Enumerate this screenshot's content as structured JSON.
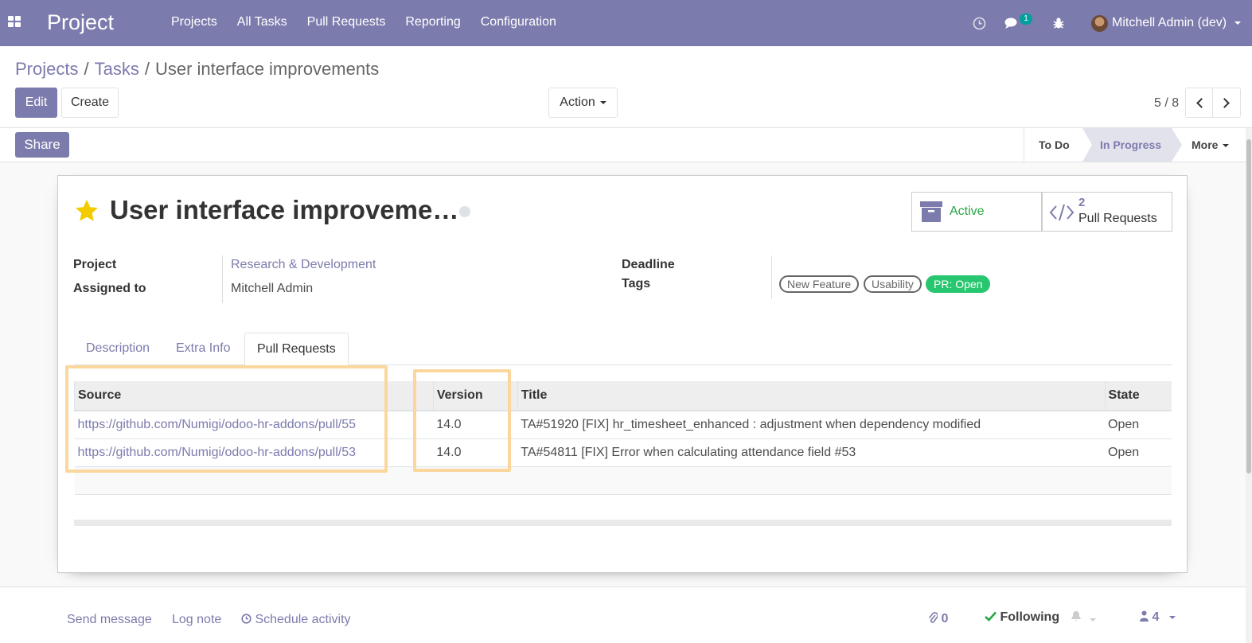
{
  "navbar": {
    "app_title": "Project",
    "menu": [
      "Projects",
      "All Tasks",
      "Pull Requests",
      "Reporting",
      "Configuration"
    ],
    "messages_count": "1",
    "user": "Mitchell Admin (dev)",
    "icons": [
      "apps-icon",
      "clock-icon",
      "comments-icon",
      "bug-icon",
      "avatar"
    ]
  },
  "breadcrumb": {
    "projects": "Projects",
    "tasks": "Tasks",
    "current": "User interface improvements",
    "separator": "/"
  },
  "toolbar": {
    "edit": "Edit",
    "create": "Create",
    "action": "Action",
    "pager": "5 / 8"
  },
  "statusbar": {
    "share": "Share",
    "stages": [
      "To Do",
      "In Progress"
    ],
    "active_stage": "In Progress",
    "more": "More"
  },
  "task": {
    "title": "User interface improveme…",
    "active_label": "Active",
    "pr_count": "2",
    "pr_label": "Pull Requests",
    "fields": {
      "project_label": "Project",
      "project_value": "Research & Development",
      "assigned_label": "Assigned to",
      "assigned_value": "Mitchell Admin",
      "deadline_label": "Deadline",
      "tags_label": "Tags"
    },
    "tags": [
      "New Feature",
      "Usability",
      "PR: Open"
    ]
  },
  "tabs": [
    "Description",
    "Extra Info",
    "Pull Requests"
  ],
  "active_tab": "Pull Requests",
  "table": {
    "headers": [
      "Source",
      "Version",
      "Title",
      "State"
    ],
    "rows": [
      {
        "source": "https://github.com/Numigi/odoo-hr-addons/pull/55",
        "version": "14.0",
        "title": "TA#51920 [FIX] hr_timesheet_enhanced : adjustment when dependency modified",
        "state": "Open"
      },
      {
        "source": "https://github.com/Numigi/odoo-hr-addons/pull/53",
        "version": "14.0",
        "title": "TA#54811 [FIX] Error when calculating attendance field #53",
        "state": "Open"
      }
    ]
  },
  "chatter": {
    "send_message": "Send message",
    "log_note": "Log note",
    "schedule_activity": "Schedule activity",
    "attachments": "0",
    "following": "Following",
    "followers": "4"
  },
  "colors": {
    "brand": "#7c7bad",
    "success": "#28c76f",
    "highlight": "#fbd79d"
  }
}
